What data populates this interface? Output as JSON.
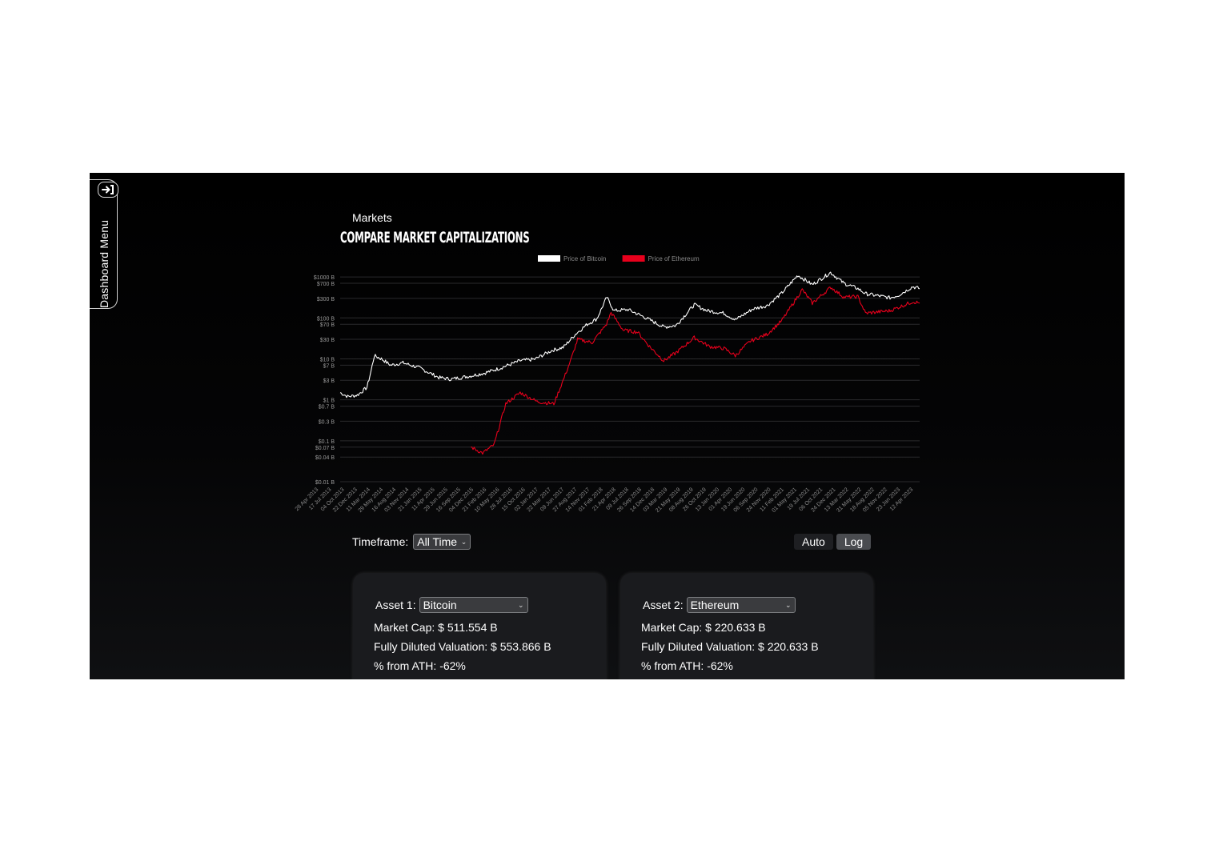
{
  "menu": {
    "label": "Dashboard Menu",
    "toggle_icon": "login-arrow-icon"
  },
  "page": {
    "eyebrow": "Markets",
    "title": "COMPARE MARKET CAPITALIZATIONS"
  },
  "chart_data": {
    "type": "line",
    "scale": "log",
    "legend_position": "top-center",
    "grid": true,
    "series": [
      {
        "name": "Price of Bitcoin",
        "color": "#ffffff",
        "x": [
          "2013-04-28",
          "2013-06-15",
          "2013-08-15",
          "2013-10-15",
          "2013-11-10",
          "2013-12-01",
          "2014-01-15",
          "2014-03-15",
          "2014-06-01",
          "2014-09-15",
          "2015-01-15",
          "2015-04-01",
          "2015-08-01",
          "2015-11-01",
          "2016-02-01",
          "2016-06-15",
          "2016-09-15",
          "2017-01-01",
          "2017-03-15",
          "2017-06-01",
          "2017-08-15",
          "2017-10-15",
          "2017-12-17",
          "2018-02-01",
          "2018-05-01",
          "2018-08-01",
          "2018-12-14",
          "2019-03-01",
          "2019-06-26",
          "2019-09-15",
          "2020-01-01",
          "2020-03-13",
          "2020-07-01",
          "2020-10-01",
          "2021-01-01",
          "2021-04-14",
          "2021-07-15",
          "2021-11-08",
          "2022-02-01",
          "2022-05-01",
          "2022-06-18",
          "2022-11-21",
          "2023-01-15",
          "2023-04-14",
          "2023-05-28"
        ],
        "values": [
          1.5,
          1.2,
          1.3,
          2.0,
          5,
          12,
          10,
          7,
          8,
          6,
          3.5,
          3.2,
          3.8,
          4.5,
          5.8,
          9,
          9.8,
          16,
          19,
          40,
          70,
          95,
          320,
          150,
          160,
          110,
          60,
          65,
          210,
          150,
          130,
          90,
          165,
          200,
          400,
          1100,
          650,
          1280,
          700,
          520,
          390,
          310,
          360,
          580,
          520
        ]
      },
      {
        "name": "Price of Ethereum",
        "color": "#e8001c",
        "x": [
          "2015-08-07",
          "2015-10-20",
          "2016-01-01",
          "2016-03-15",
          "2016-06-15",
          "2016-10-01",
          "2017-01-15",
          "2017-03-15",
          "2017-05-01",
          "2017-06-15",
          "2017-09-15",
          "2017-12-15",
          "2018-01-13",
          "2018-04-01",
          "2018-07-01",
          "2018-09-15",
          "2018-12-14",
          "2019-03-01",
          "2019-06-26",
          "2019-10-01",
          "2020-01-01",
          "2020-03-13",
          "2020-06-15",
          "2020-10-01",
          "2021-01-01",
          "2021-05-12",
          "2021-07-15",
          "2021-11-10",
          "2022-02-01",
          "2022-05-01",
          "2022-06-18",
          "2022-11-21",
          "2023-04-15",
          "2023-05-28"
        ],
        "values": [
          0.07,
          0.05,
          0.08,
          0.8,
          1.5,
          0.9,
          0.8,
          3,
          9,
          30,
          25,
          70,
          135,
          50,
          45,
          20,
          9,
          14,
          33,
          20,
          18,
          12,
          27,
          40,
          85,
          490,
          230,
          560,
          320,
          330,
          130,
          150,
          250,
          230
        ]
      }
    ],
    "y_ticks": [
      "$1000 B",
      "$700 B",
      "$300 B",
      "$100 B",
      "$70 B",
      "$30 B",
      "$10 B",
      "$7 B",
      "$3 B",
      "$1 B",
      "$0.7 B",
      "$0.3 B",
      "$0.1 B",
      "$0.07 B",
      "$0.04 B",
      "$0.01 B"
    ],
    "y_tick_values": [
      1000,
      700,
      300,
      100,
      70,
      30,
      10,
      7,
      3,
      1,
      0.7,
      0.3,
      0.1,
      0.07,
      0.04,
      0.01
    ],
    "x_ticks": [
      "28 Apr 2013",
      "17 Jul 2013",
      "04 Oct 2013",
      "22 Dec 2013",
      "11 Mar 2014",
      "29 May 2014",
      "16 Aug 2014",
      "03 Nov 2014",
      "21 Jan 2015",
      "11 Apr 2015",
      "29 Jun 2015",
      "16 Sep 2015",
      "04 Dec 2015",
      "21 Feb 2016",
      "10 May 2016",
      "28 Jul 2016",
      "15 Oct 2016",
      "02 Jan 2017",
      "22 Mar 2017",
      "09 Jun 2017",
      "27 Aug 2017",
      "14 Nov 2017",
      "01 Feb 2018",
      "21 Apr 2018",
      "09 Jul 2018",
      "26 Sep 2018",
      "14 Dec 2018",
      "03 Mar 2019",
      "21 May 2019",
      "08 Aug 2019",
      "26 Oct 2019",
      "13 Jan 2020",
      "01 Apr 2020",
      "19 Jun 2020",
      "06 Sep 2020",
      "24 Nov 2020",
      "11 Feb 2021",
      "01 May 2021",
      "19 Jul 2021",
      "06 Oct 2021",
      "24 Dec 2021",
      "13 Mar 2022",
      "31 May 2022",
      "18 Aug 2022",
      "05 Nov 2022",
      "23 Jan 2023",
      "12 Apr 2023"
    ],
    "x_range": [
      "2013-04-28",
      "2023-05-28"
    ],
    "y_range": [
      0.01,
      1100
    ]
  },
  "controls": {
    "timeframe_label": "Timeframe:",
    "timeframe_value": "All Time",
    "scale_auto": "Auto",
    "scale_log": "Log"
  },
  "assets": [
    {
      "label": "Asset 1:",
      "value": "Bitcoin",
      "market_cap": "Market Cap: $ 511.554 B",
      "fdv": "Fully Diluted Valuation: $ 553.866 B",
      "ath": "% from ATH: -62%"
    },
    {
      "label": "Asset 2:",
      "value": "Ethereum",
      "market_cap": "Market Cap: $ 220.633 B",
      "fdv": "Fully Diluted Valuation: $ 220.633 B",
      "ath": "% from ATH: -62%"
    }
  ]
}
